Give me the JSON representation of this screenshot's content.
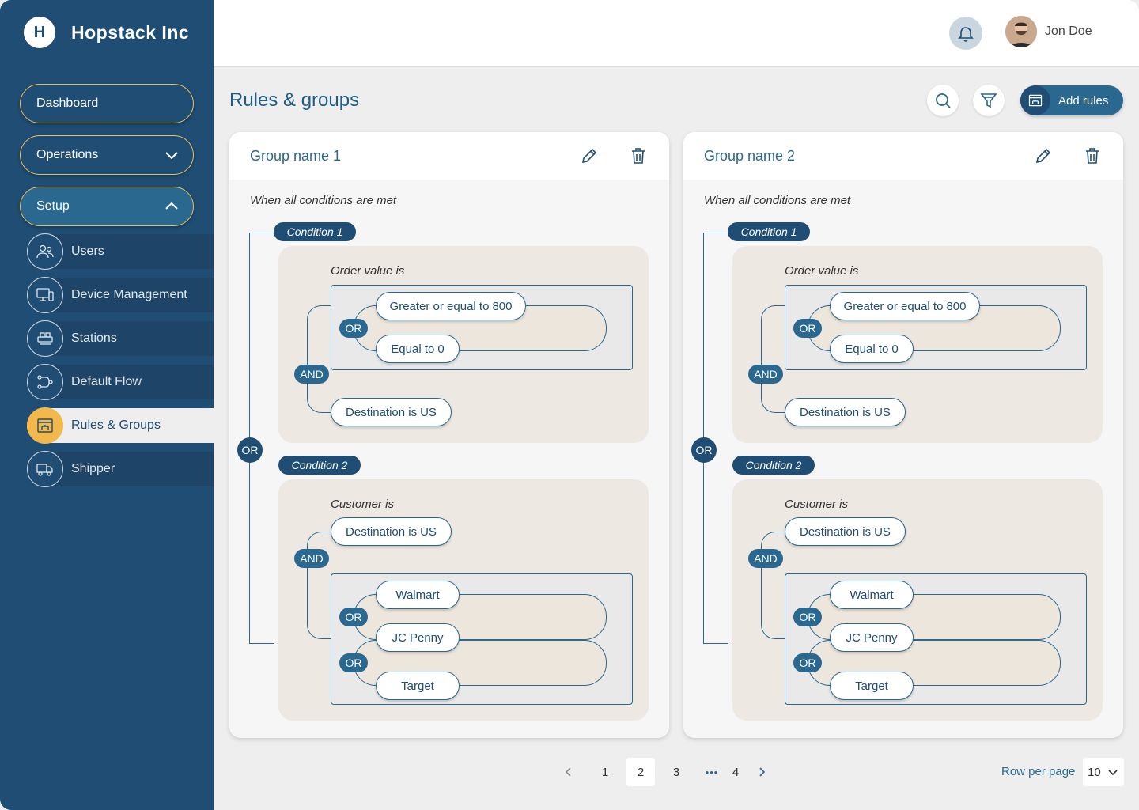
{
  "brand": {
    "name": "Hopstack Inc",
    "logo_letter": "H"
  },
  "header": {
    "user_name": "Jon Doe"
  },
  "sidebar": {
    "pills": [
      {
        "label": "Dashboard"
      },
      {
        "label": "Operations"
      },
      {
        "label": "Setup"
      }
    ],
    "items": [
      {
        "label": "Users",
        "icon": "users-icon"
      },
      {
        "label": "Device Management",
        "icon": "devices-icon"
      },
      {
        "label": "Stations",
        "icon": "stations-icon"
      },
      {
        "label": "Default Flow",
        "icon": "flow-icon"
      },
      {
        "label": "Rules & Groups",
        "icon": "rules-icon",
        "active": true
      },
      {
        "label": "Shipper",
        "icon": "shipper-icon"
      }
    ]
  },
  "page": {
    "title": "Rules & groups",
    "add_button": "Add rules"
  },
  "groups": [
    {
      "name": "Group name 1",
      "subtitle": "When all conditions are met",
      "or_label": "OR",
      "condition1": {
        "tag": "Condition 1",
        "heading": "Order value is",
        "and_label": "AND",
        "or_label": "OR",
        "opt1_text": "Greater or equal to ",
        "opt1_value": "800",
        "opt2_text": "Equal to ",
        "opt2_value": "0",
        "dest_text": "Destination is ",
        "dest_value": "US"
      },
      "condition2": {
        "tag": "Condition 2",
        "heading": "Customer is",
        "and_label": "AND",
        "or1_label": "OR",
        "or2_label": "OR",
        "dest_text": "Destination is ",
        "dest_value": "US",
        "customers": [
          "Walmart",
          "JC Penny",
          "Target"
        ]
      }
    },
    {
      "name": "Group name 2",
      "subtitle": "When all conditions are met",
      "or_label": "OR",
      "condition1": {
        "tag": "Condition 1",
        "heading": "Order value is",
        "and_label": "AND",
        "or_label": "OR",
        "opt1_text": "Greater or equal to ",
        "opt1_value": "800",
        "opt2_text": "Equal to ",
        "opt2_value": "0",
        "dest_text": "Destination is ",
        "dest_value": "US"
      },
      "condition2": {
        "tag": "Condition 2",
        "heading": "Customer is",
        "and_label": "AND",
        "or1_label": "OR",
        "or2_label": "OR",
        "dest_text": "Destination is ",
        "dest_value": "US",
        "customers": [
          "Walmart",
          "JC Penny",
          "Target"
        ]
      }
    }
  ],
  "pagination": {
    "pages": [
      "1",
      "2",
      "3",
      "4"
    ],
    "current": "2",
    "ellipsis": "•••",
    "rows_label": "Row per page",
    "rows_value": "10"
  },
  "colors": {
    "sidebar": "#1f4d73",
    "accent": "#2a6890",
    "highlight": "#f2b84b",
    "pill_border": "#e6c15c"
  }
}
